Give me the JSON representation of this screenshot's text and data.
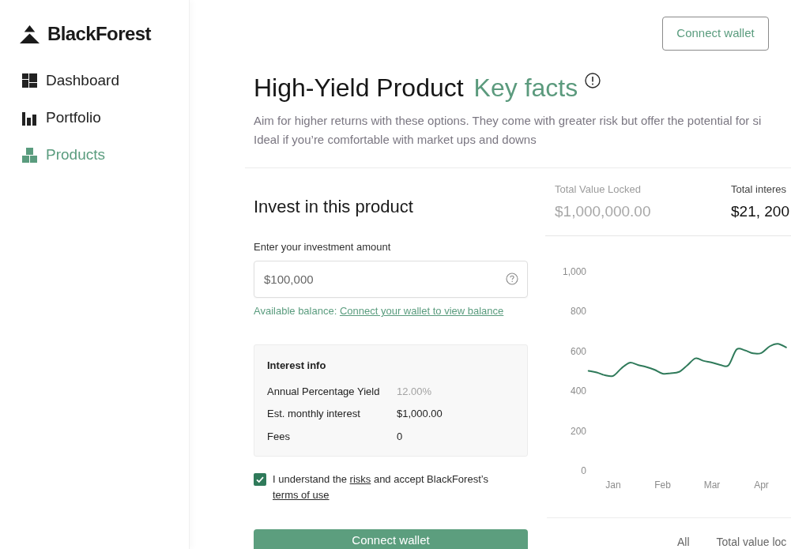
{
  "sidebar": {
    "brand": "BlackForest",
    "items": [
      {
        "label": "Dashboard",
        "selected": false
      },
      {
        "label": "Portfolio",
        "selected": false
      },
      {
        "label": "Products",
        "selected": true
      }
    ]
  },
  "header": {
    "button": "Connect wallet"
  },
  "title": {
    "text": "High-Yield Product",
    "accent": "Key facts"
  },
  "description": [
    "Aim for higher returns with these options. They come with greater risk but offer the potential for si",
    "Ideal if you’re comfortable with market ups and downs"
  ],
  "invest": {
    "heading": "Invest in this product",
    "amount": {
      "label": "Enter your investment amount",
      "value": "$100,000"
    },
    "balance": [
      {
        "kind": "text",
        "text": "Available balance: "
      },
      {
        "kind": "link",
        "text": "Connect your wallet to view balance"
      }
    ],
    "interest_info": {
      "title": "Interest info",
      "rows": [
        {
          "label": "Annual Percentage Yield",
          "value": "12.00%",
          "muted": true
        },
        {
          "label": "Est. monthly interest",
          "value": "$1,000.00",
          "muted": false
        },
        {
          "label": "Fees",
          "value": "0",
          "muted": false
        }
      ]
    },
    "agreement": {
      "checked": true,
      "parts": [
        {
          "kind": "text",
          "text": "I understand the "
        },
        {
          "kind": "link",
          "text": "risks"
        },
        {
          "kind": "text",
          "text": " and accept BlackForest’s "
        },
        {
          "kind": "link",
          "text": "terms of use"
        }
      ]
    },
    "button": "Connect wallet"
  },
  "stats": [
    {
      "label": "Total Value Locked",
      "value": "$1,000,000.00",
      "dimmed": true
    },
    {
      "label": "Total interes",
      "value": "$21, 200",
      "dimmed": false
    }
  ],
  "chart": {
    "chart_data": {
      "type": "line",
      "categories": [
        null,
        null,
        null,
        "Jan",
        null,
        null,
        null,
        null,
        null,
        "Feb",
        null,
        null,
        null,
        null,
        null,
        "Mar",
        null,
        null,
        null,
        null,
        null,
        "Apr",
        null,
        null,
        null
      ],
      "series": [
        {
          "color": "#2f7a5a",
          "values": [
            502,
            494,
            480,
            477,
            515,
            543,
            532,
            522,
            508,
            488,
            490,
            497,
            530,
            565,
            552,
            544,
            532,
            530,
            610,
            605,
            590,
            592,
            625,
            638,
            620
          ]
        }
      ],
      "ylim": [
        0,
        1000
      ],
      "yticks": [
        0,
        200,
        400,
        600,
        800,
        {
          "value": 1000,
          "label": "1,000"
        }
      ]
    },
    "tabs": [
      {
        "label": "All"
      },
      {
        "label": "Total value loc"
      }
    ]
  }
}
